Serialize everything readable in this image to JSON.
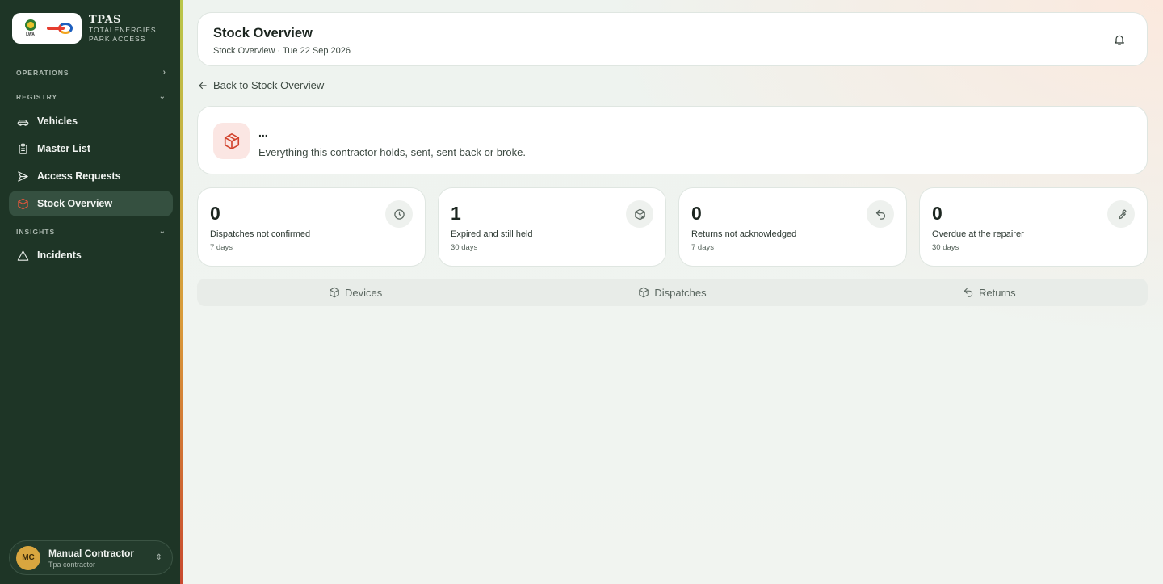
{
  "brand": {
    "title": "TPAS",
    "subtitle_line1": "TOTALENERGIES",
    "subtitle_line2": "PARK ACCESS",
    "logo_lwa_text": "LWA"
  },
  "sidebar": {
    "sections": [
      {
        "label": "OPERATIONS",
        "chevron": "›"
      },
      {
        "label": "REGISTRY",
        "chevron": "⌄"
      },
      {
        "label": "INSIGHTS",
        "chevron": "⌄"
      }
    ],
    "items": [
      {
        "label": "Vehicles",
        "icon": "car-icon"
      },
      {
        "label": "Master List",
        "icon": "clipboard-icon"
      },
      {
        "label": "Access Requests",
        "icon": "send-icon"
      },
      {
        "label": "Stock Overview",
        "icon": "box-icon",
        "active": true
      },
      {
        "label": "Incidents",
        "icon": "warning-icon"
      }
    ]
  },
  "user": {
    "initials": "MC",
    "name": "Manual Contractor",
    "role": "Tpa contractor",
    "toggle": "⇕"
  },
  "header": {
    "title": "Stock Overview",
    "subtitle": "Stock Overview · Tue 22 Sep 2026"
  },
  "back_link": "Back to Stock Overview",
  "contractor": {
    "name": "...",
    "description": "Everything this contractor holds, sent, sent back or broke."
  },
  "stats": [
    {
      "value": "0",
      "label": "Dispatches not confirmed",
      "sub": "7 days",
      "icon": "clock-icon"
    },
    {
      "value": "1",
      "label": "Expired and still held",
      "sub": "30 days",
      "icon": "box-x-icon"
    },
    {
      "value": "0",
      "label": "Returns not acknowledged",
      "sub": "7 days",
      "icon": "undo-icon"
    },
    {
      "value": "0",
      "label": "Overdue at the repairer",
      "sub": "30 days",
      "icon": "wrench-icon"
    }
  ],
  "tabs": [
    {
      "label": "Devices",
      "icon": "box-icon"
    },
    {
      "label": "Dispatches",
      "icon": "box-icon"
    },
    {
      "label": "Returns",
      "icon": "undo-icon"
    }
  ],
  "colors": {
    "sidebar_bg": "#1e3526",
    "active_item_bg": "#355040",
    "accent_red": "#c8492f",
    "avatar_bg": "#d9a63f"
  }
}
